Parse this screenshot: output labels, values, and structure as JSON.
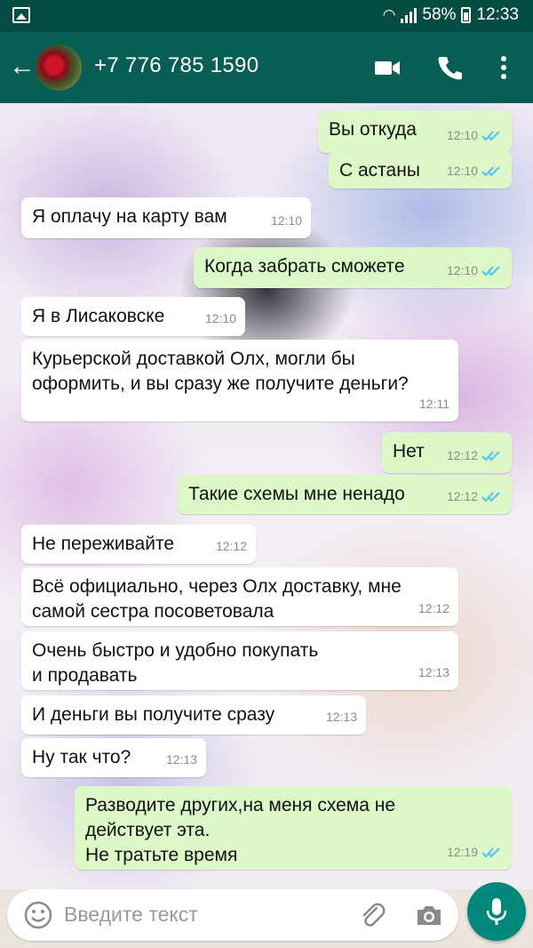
{
  "status_bar": {
    "battery": "58%",
    "time": "12:33"
  },
  "header": {
    "contact": "+7 776 785 1590"
  },
  "messages": [
    {
      "dir": "out",
      "text": "Вы откуда",
      "time": "12:10"
    },
    {
      "dir": "out",
      "text": "С астаны",
      "time": "12:10"
    },
    {
      "dir": "in",
      "text": "Я оплачу на карту вам",
      "time": "12:10"
    },
    {
      "dir": "out",
      "text": "Когда забрать сможете",
      "time": "12:10"
    },
    {
      "dir": "in",
      "text": "Я в Лисаковске",
      "time": "12:10"
    },
    {
      "dir": "in",
      "text": "Курьерской доставкой Олх, могли бы\nоформить, и вы сразу же получите деньги?",
      "time": "12:11"
    },
    {
      "dir": "out",
      "text": "Нет",
      "time": "12:12"
    },
    {
      "dir": "out",
      "text": "Такие схемы мне ненадо",
      "time": "12:12"
    },
    {
      "dir": "in",
      "text": "Не переживайте",
      "time": "12:12"
    },
    {
      "dir": "in",
      "text": "Всё официально, через Олх доставку, мне\nсамой сестра посоветовала",
      "time": "12:12"
    },
    {
      "dir": "in",
      "text": "Очень быстро и удобно покупать\nи продавать",
      "time": "12:13"
    },
    {
      "dir": "in",
      "text": "И деньги вы получите сразу",
      "time": "12:13"
    },
    {
      "dir": "in",
      "text": "Ну так что?",
      "time": "12:13"
    },
    {
      "dir": "out",
      "text": "Разводите других,на меня схема не\nдействует эта.\nНе тратьте время",
      "time": "12:19"
    }
  ],
  "input": {
    "placeholder": "Введите текст"
  },
  "colors": {
    "header": "#075e54",
    "statusbar": "#054d44",
    "outgoing": "#dcf8c6",
    "incoming": "#ffffff",
    "read_tick": "#4fc3f7",
    "fab": "#00897b"
  }
}
